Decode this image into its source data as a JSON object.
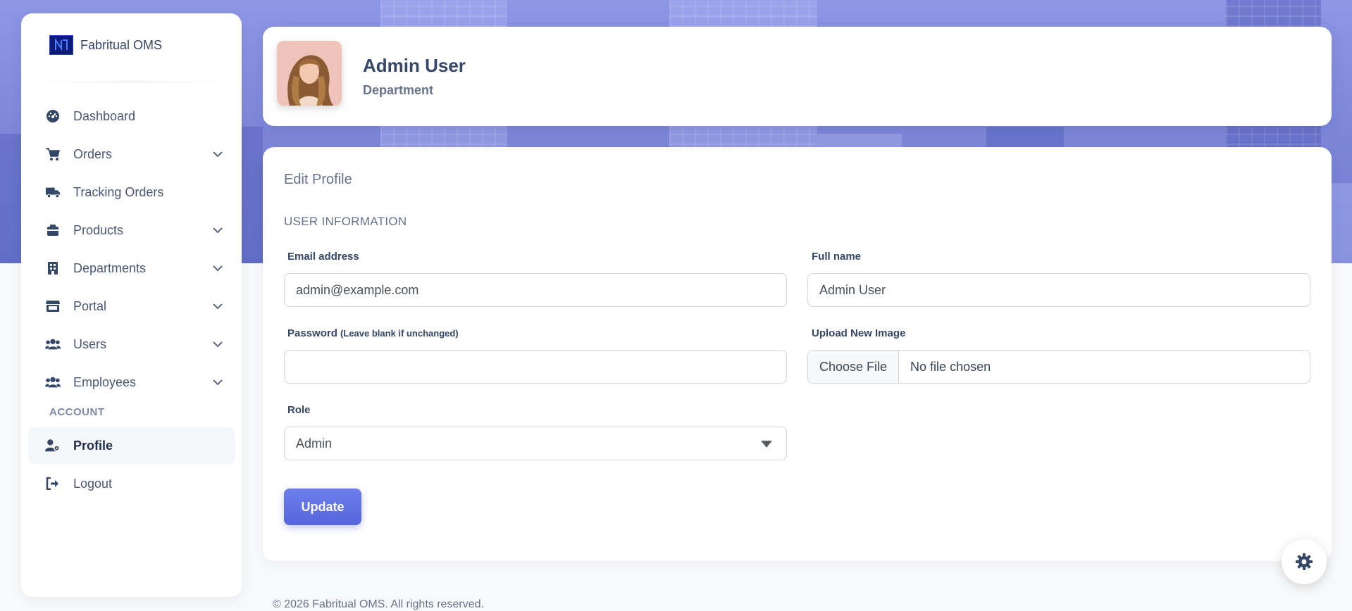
{
  "brand": {
    "name": "Fabritual OMS",
    "logo_icon": "brand-logo-icon"
  },
  "sidebar": {
    "items": [
      {
        "label": "Dashboard",
        "icon": "dashboard-icon",
        "has_submenu": false
      },
      {
        "label": "Orders",
        "icon": "cart-icon",
        "has_submenu": true
      },
      {
        "label": "Tracking Orders",
        "icon": "truck-icon",
        "has_submenu": false
      },
      {
        "label": "Products",
        "icon": "box-icon",
        "has_submenu": true
      },
      {
        "label": "Departments",
        "icon": "building-icon",
        "has_submenu": true
      },
      {
        "label": "Portal",
        "icon": "store-icon",
        "has_submenu": true
      },
      {
        "label": "Users",
        "icon": "users-icon",
        "has_submenu": true
      },
      {
        "label": "Employees",
        "icon": "users-icon",
        "has_submenu": true
      }
    ],
    "account_label": "ACCOUNT",
    "account_items": [
      {
        "label": "Profile",
        "icon": "user-gear-icon",
        "active": true
      },
      {
        "label": "Logout",
        "icon": "logout-icon",
        "active": false
      }
    ]
  },
  "profile": {
    "name": "Admin User",
    "department": "Department"
  },
  "edit": {
    "title": "Edit Profile",
    "section": "USER INFORMATION",
    "email_label": "Email address",
    "email_value": "admin@example.com",
    "fullname_label": "Full name",
    "fullname_value": "Admin User",
    "password_label": "Password",
    "password_hint": "(Leave blank if unchanged)",
    "password_value": "",
    "upload_label": "Upload New Image",
    "file_button": "Choose File",
    "file_status": "No file chosen",
    "role_label": "Role",
    "role_value": "Admin",
    "update_label": "Update"
  },
  "footer": {
    "text": "© 2026 Fabritual OMS. All rights reserved."
  },
  "colors": {
    "accent": "#5566dd",
    "hero": "#7b86d8",
    "text": "#344767"
  }
}
